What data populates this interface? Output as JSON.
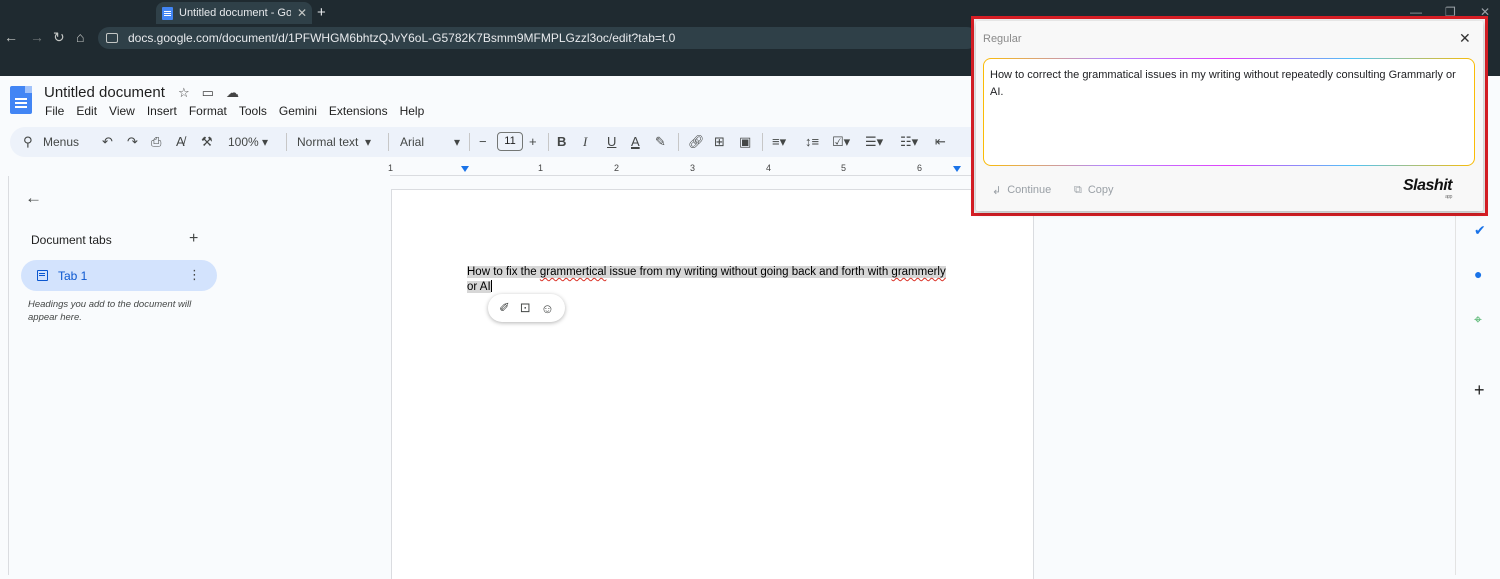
{
  "browser": {
    "tab_title": "Untitled document - Goo",
    "url": "docs.google.com/document/d/1PFWHGM6bhtzQJvY6oL-G5782K7Bsmm9MFMPLGzzl3oc/edit?tab=t.0"
  },
  "docs": {
    "title": "Untitled document",
    "menus": [
      "File",
      "Edit",
      "View",
      "Insert",
      "Format",
      "Tools",
      "Gemini",
      "Extensions",
      "Help"
    ],
    "toolbar": {
      "menus_search": "Menus",
      "zoom": "100%",
      "style": "Normal text",
      "font": "Arial",
      "font_size": "11"
    },
    "ruler_ticks": [
      "1",
      "1",
      "2",
      "3",
      "4",
      "5",
      "6"
    ],
    "left_panel": {
      "heading": "Document tabs",
      "tab_label": "Tab 1",
      "hint": "Headings you add to the document will appear here."
    },
    "body": {
      "part1": "How to fix the ",
      "err1": "grammertical",
      "part2": " issue from my writing without going back and forth with ",
      "err2": "grammerly",
      "part3": " or AI"
    }
  },
  "popup": {
    "mode": "Regular",
    "text": "How to correct the grammatical issues in my writing without repeatedly consulting Grammarly or AI.",
    "continue_label": "Continue",
    "copy_label": "Copy",
    "logo": "Slashit"
  },
  "colors": {
    "highlight_border": "#d81e25",
    "accent": "#0b57d0",
    "tab_selected_bg": "#d3e3fd"
  }
}
